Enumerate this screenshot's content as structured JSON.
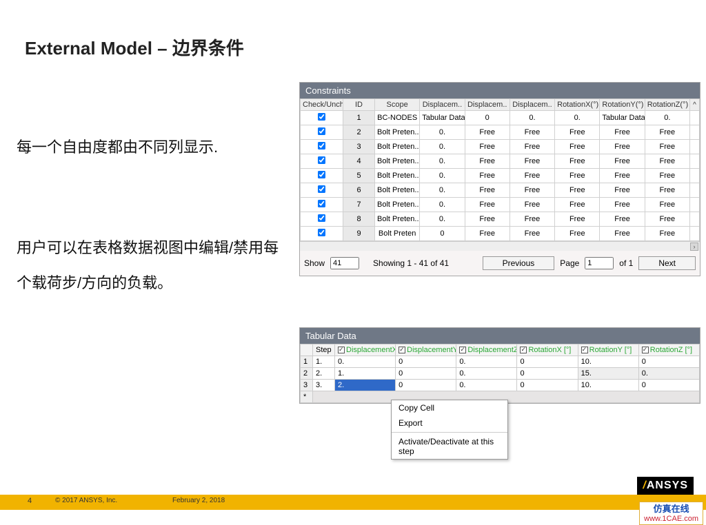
{
  "title": "External Model – 边界条件",
  "paragraph1": "每一个自由度都由不同列显示.",
  "paragraph2": "用户可以在表格数据视图中编辑/禁用每个载荷步/方向的负载。",
  "constraints": {
    "header": "Constraints",
    "columns": [
      "Check/Uncheck",
      "ID",
      "Scope",
      "Displacem..",
      "Displacem..",
      "Displacem..",
      "RotationX(°)",
      "RotationY(°)",
      "RotationZ(°)"
    ],
    "caret": "^",
    "rows": [
      {
        "id": "1",
        "scope": "BC-NODES",
        "dx": "Tabular Data",
        "dy": "0",
        "dz": "0.",
        "rx": "0.",
        "ry": "Tabular Data",
        "rz": "0."
      },
      {
        "id": "2",
        "scope": "Bolt Preten..",
        "dx": "0.",
        "dy": "Free",
        "dz": "Free",
        "rx": "Free",
        "ry": "Free",
        "rz": "Free"
      },
      {
        "id": "3",
        "scope": "Bolt Preten..",
        "dx": "0.",
        "dy": "Free",
        "dz": "Free",
        "rx": "Free",
        "ry": "Free",
        "rz": "Free"
      },
      {
        "id": "4",
        "scope": "Bolt Preten..",
        "dx": "0.",
        "dy": "Free",
        "dz": "Free",
        "rx": "Free",
        "ry": "Free",
        "rz": "Free"
      },
      {
        "id": "5",
        "scope": "Bolt Preten..",
        "dx": "0.",
        "dy": "Free",
        "dz": "Free",
        "rx": "Free",
        "ry": "Free",
        "rz": "Free"
      },
      {
        "id": "6",
        "scope": "Bolt Preten..",
        "dx": "0.",
        "dy": "Free",
        "dz": "Free",
        "rx": "Free",
        "ry": "Free",
        "rz": "Free"
      },
      {
        "id": "7",
        "scope": "Bolt Preten..",
        "dx": "0.",
        "dy": "Free",
        "dz": "Free",
        "rx": "Free",
        "ry": "Free",
        "rz": "Free"
      },
      {
        "id": "8",
        "scope": "Bolt Preten..",
        "dx": "0.",
        "dy": "Free",
        "dz": "Free",
        "rx": "Free",
        "ry": "Free",
        "rz": "Free"
      },
      {
        "id": "9",
        "scope": "Bolt Preten",
        "dx": "0",
        "dy": "Free",
        "dz": "Free",
        "rx": "Free",
        "ry": "Free",
        "rz": "Free"
      }
    ],
    "pager": {
      "show_label": "Show",
      "show_value": "41",
      "status": "Showing 1 - 41 of 41",
      "prev": "Previous",
      "page_label": "Page",
      "page_value": "1",
      "of_label": "of 1",
      "next": "Next"
    }
  },
  "tabular": {
    "header": "Tabular Data",
    "columns": [
      "",
      "Step",
      "DisplacementX [m]",
      "DisplacementY [m]",
      "DisplacementZ [m]",
      "RotationX [°]",
      "RotationY [°]",
      "RotationZ [°]"
    ],
    "rows": [
      {
        "idx": "1",
        "step": "1.",
        "dx": "0.",
        "dy": "0",
        "dz": "0.",
        "rx": "0",
        "ry": "10.",
        "rz": "0"
      },
      {
        "idx": "2",
        "step": "2.",
        "dx": "1.",
        "dy": "0",
        "dz": "0.",
        "rx": "0",
        "ry": "15.",
        "rz": "0."
      },
      {
        "idx": "3",
        "step": "3.",
        "dx": "2.",
        "dy": "0",
        "dz": "0.",
        "rx": "0",
        "ry": "10.",
        "rz": "0"
      }
    ],
    "star": "*"
  },
  "context_menu": {
    "copy": "Copy Cell",
    "export": "Export",
    "toggle": "Activate/Deactivate at this step"
  },
  "footer": {
    "page_num": "4",
    "copyright": "© 2017 ANSYS, Inc.",
    "date": "February 2, 2018"
  },
  "logo": {
    "brand": "ANSYS"
  },
  "watermark": {
    "line1": "仿真在线",
    "line2": "www.1CAE.com"
  },
  "faint_watermark": "1CAE.COM"
}
